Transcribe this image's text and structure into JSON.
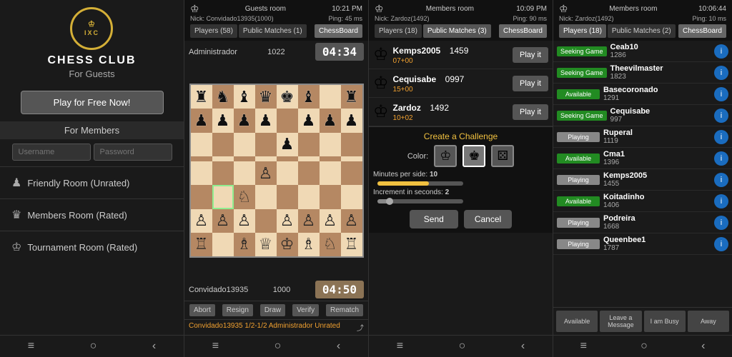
{
  "panel1": {
    "title": "CHESS CLUB",
    "subtitle": "For Guests",
    "play_btn": "Play for Free Now!",
    "for_members": "For Members",
    "username_placeholder": "Username",
    "password_placeholder": "Password",
    "rooms": [
      {
        "icon": "♟",
        "label": "Friendly Room (Unrated)"
      },
      {
        "icon": "♛",
        "label": "Members Room (Rated)"
      },
      {
        "icon": "♔",
        "label": "Tournament Room (Rated)"
      }
    ],
    "nav": [
      "≡",
      "○",
      "‹"
    ]
  },
  "panel2": {
    "room_name": "Guests room",
    "time": "10:21 PM",
    "nick": "Nick: Convidado13935(1000)",
    "ping": "Ping: 45 ms",
    "tabs": [
      {
        "label": "Players (58)",
        "active": false
      },
      {
        "label": "Public Matches (1)",
        "active": false
      },
      {
        "label": "ChessBoard",
        "active": true
      }
    ],
    "admin_name": "Administrador",
    "admin_rating": "1022",
    "admin_timer": "04:34",
    "player_name": "Convidado13935",
    "player_rating": "1000",
    "player_timer": "04:50",
    "actions": [
      "Abort",
      "Resign",
      "Draw",
      "Verify",
      "Rematch"
    ],
    "chat": "Convidado13935 1/2-1/2 Administrador Unrated"
  },
  "panel3": {
    "room_name": "Members room",
    "time": "10:09 PM",
    "nick": "Nick: Zardoz(1492)",
    "ping": "Ping: 90 ms",
    "tabs": [
      {
        "label": "Players (18)",
        "active": false
      },
      {
        "label": "Public Matches (3)",
        "active": false
      },
      {
        "label": "ChessBoard",
        "active": true
      }
    ],
    "matches": [
      {
        "name": "Kemps2005",
        "rating": "1459",
        "sub": "07+00"
      },
      {
        "name": "Cequisabe",
        "rating": "0997",
        "sub": "15+00"
      },
      {
        "name": "Zardoz",
        "rating": "1492",
        "sub": "10+02"
      }
    ],
    "challenge": {
      "title": "Create a Challenge",
      "color_label": "Color:",
      "minutes_label": "Minutes per side:",
      "minutes_value": "10",
      "increment_label": "Increment in seconds:",
      "increment_value": "2",
      "send_btn": "Send",
      "cancel_btn": "Cancel"
    }
  },
  "panel4": {
    "room_name": "Members room",
    "time": "10:06:44",
    "nick": "Nick: Zardoz(1492)",
    "ping": "Ping: 10 ms",
    "tabs": [
      {
        "label": "Players (18)",
        "active": false
      },
      {
        "label": "Public Matches (2)",
        "active": false
      },
      {
        "label": "ChessBoard",
        "active": true
      }
    ],
    "members": [
      {
        "status": "Seeking Game",
        "status_type": "seeking",
        "name": "Ceab10",
        "rating": "1286"
      },
      {
        "status": "Seeking Game",
        "status_type": "seeking",
        "name": "Theevilmaster",
        "rating": "1823"
      },
      {
        "status": "Available",
        "status_type": "available",
        "name": "Basecoronado",
        "rating": "1291"
      },
      {
        "status": "Seeking Game",
        "status_type": "seeking",
        "name": "Cequisabe",
        "rating": "997"
      },
      {
        "status": "Playing",
        "status_type": "playing",
        "name": "Ruperal",
        "rating": "1119"
      },
      {
        "status": "Available",
        "status_type": "available",
        "name": "Cma1",
        "rating": "1396"
      },
      {
        "status": "Playing",
        "status_type": "playing",
        "name": "Kemps2005",
        "rating": "1455"
      },
      {
        "status": "Available",
        "status_type": "available",
        "name": "Koitadinho",
        "rating": "1406"
      },
      {
        "status": "Playing",
        "status_type": "playing",
        "name": "Podreira",
        "rating": "1668"
      },
      {
        "status": "Playing",
        "status_type": "playing",
        "name": "Queenbee1",
        "rating": "1787"
      }
    ],
    "footer_btns": [
      "Available",
      "Leave a Message",
      "I am Busy",
      "Away"
    ]
  },
  "board": {
    "pieces": [
      [
        "♜",
        "♞",
        "♝",
        "♛",
        "♚",
        "♝",
        "",
        "♜"
      ],
      [
        "♟",
        "♟",
        "♟",
        "♟",
        "",
        "♟",
        "♟",
        "♟"
      ],
      [
        "",
        "",
        "",
        "",
        "♟",
        "",
        "",
        ""
      ],
      [
        "",
        "",
        "",
        "",
        "",
        "",
        "",
        ""
      ],
      [
        "",
        "",
        "",
        "♙",
        "",
        "",
        "",
        ""
      ],
      [
        "",
        "",
        "♘",
        "",
        "",
        "",
        "",
        ""
      ],
      [
        "♙",
        "♙",
        "♙",
        "",
        "♙",
        "♙",
        "♙",
        "♙"
      ],
      [
        "♖",
        "",
        "♗",
        "♕",
        "♔",
        "♗",
        "♘",
        "♖"
      ]
    ],
    "highlight_cell": "b3"
  }
}
